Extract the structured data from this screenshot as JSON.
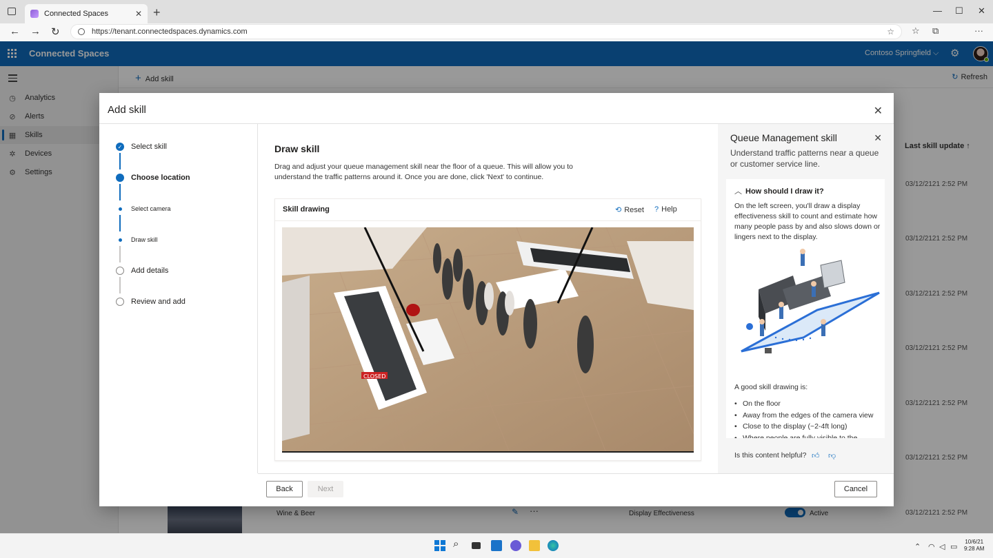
{
  "browser": {
    "tab_title": "Connected Spaces",
    "tab_close": "✕",
    "new_tab": "+",
    "url": "https://tenant.connectedspaces.dynamics.com",
    "minimize": "—",
    "maximize": "☐",
    "close": "✕"
  },
  "app": {
    "name": "Connected Spaces",
    "org": "Contoso Springfield ⌵"
  },
  "leftnav": {
    "items": [
      {
        "label": "Analytics",
        "icon": "analytics-icon"
      },
      {
        "label": "Alerts",
        "icon": "alert-icon"
      },
      {
        "label": "Skills",
        "icon": "skills-icon",
        "active": true
      },
      {
        "label": "Devices",
        "icon": "devices-icon"
      },
      {
        "label": "Settings",
        "icon": "gear-icon"
      }
    ]
  },
  "commandbar": {
    "add_skill": "Add skill",
    "refresh": "Refresh"
  },
  "table": {
    "last_update_header": "Last skill update ↑",
    "dates": [
      "03/12/2121 2:52 PM",
      "03/12/2121 2:52 PM",
      "03/12/2121 2:52 PM",
      "03/12/2121 2:52 PM",
      "03/12/2121 2:52 PM",
      "03/12/2121 2:52 PM",
      "03/12/2121 2:52 PM",
      "03/12/2121 2:52 PM"
    ],
    "visible_row": {
      "name": "Wine & Beer",
      "type": "Display Effectiveness",
      "status": "Active",
      "more": "···"
    }
  },
  "dialog": {
    "title": "Add skill",
    "close": "✕",
    "steps": [
      {
        "label": "Select skill",
        "state": "done"
      },
      {
        "label": "Choose location",
        "state": "current"
      },
      {
        "label": "Select camera",
        "state": "sub"
      },
      {
        "label": "Draw skill",
        "state": "sub"
      },
      {
        "label": "Add details",
        "state": "pending"
      },
      {
        "label": "Review and add",
        "state": "pending"
      }
    ],
    "main": {
      "title": "Draw skill",
      "description": "Drag and adjust your queue management skill near the floor of a queue. This will allow you to understand the traffic patterns around it. Once you are done, click 'Next' to continue.",
      "card_title": "Skill drawing",
      "reset": "Reset",
      "help": "Help",
      "camera_sign": "CLOSED"
    },
    "panel": {
      "title": "Queue Management skill",
      "close": "✕",
      "subtitle": "Understand traffic patterns near a queue or customer service line.",
      "accordion_title": "How should I draw it?",
      "accordion_chevron": "︿",
      "accordion_text": "On the left screen, you'll draw a display effectiveness skill to count and estimate how many people pass by and also slows down or lingers next to the display.",
      "good_heading": "A good skill drawing is:",
      "bullets": [
        "On the floor",
        "Away from the edges of the camera view",
        "Close to the display (~2-4ft long)",
        "Where people are fully visible to the"
      ],
      "helpful": "Is this content helpful?"
    },
    "buttons": {
      "back": "Back",
      "next": "Next",
      "cancel": "Cancel"
    }
  },
  "taskbar": {
    "time": "9:28 AM",
    "date": "10/6/21"
  },
  "colors": {
    "brand": "#0f6cbd",
    "overlay": "rgba(0,0,0,0.4)"
  }
}
